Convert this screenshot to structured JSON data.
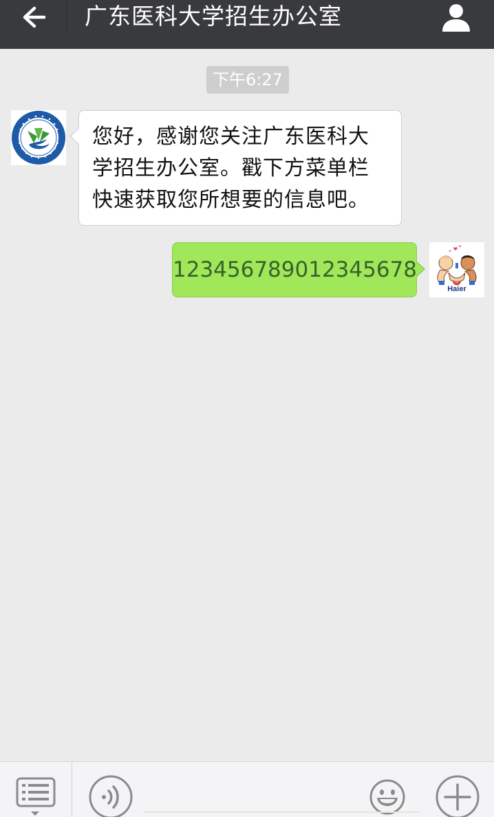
{
  "header": {
    "title": "广东医科大学招生办公室",
    "background": "#393a3e"
  },
  "chat": {
    "background": "#ebebeb",
    "timestamp": "下午6:27",
    "messages": [
      {
        "direction": "incoming",
        "avatar": "university-logo",
        "text": "您好，感谢您关注广东医科大学招生办公室。戳下方菜单栏快速获取您所想要的信息吧。"
      },
      {
        "direction": "outgoing",
        "avatar": "haier-brothers-avatar",
        "avatar_text": "Haier",
        "text": "123456789012345678",
        "bubble_color": "#a0e75a"
      }
    ]
  },
  "bottom_bar": {
    "menu_icon": "menu-list-icon",
    "voice_icon": "voice-icon",
    "emoji_icon": "emoji-icon",
    "plus_icon": "plus-icon",
    "input_value": ""
  }
}
